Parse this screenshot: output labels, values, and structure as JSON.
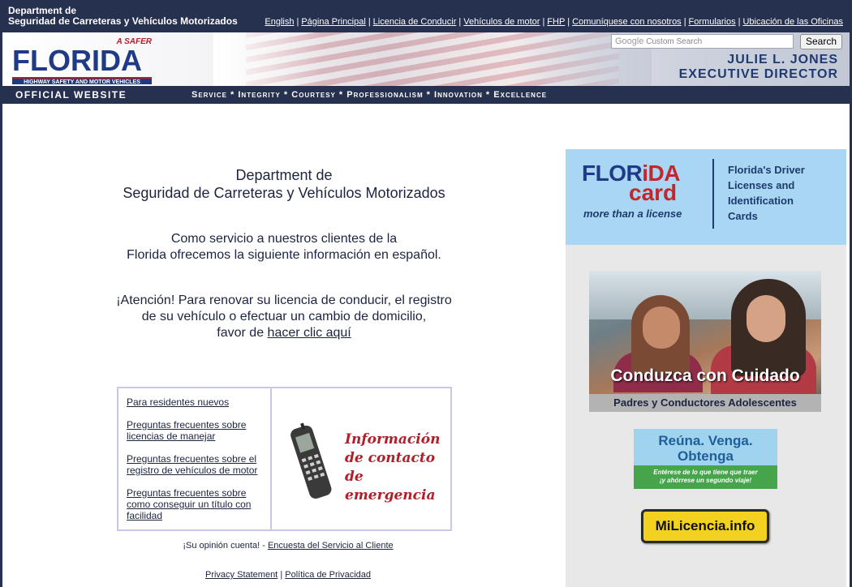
{
  "header": {
    "dept_line1": "Department de",
    "dept_line2": "Seguridad de Carreteras y Vehículos Motorizados",
    "links": [
      "English",
      "Página Principal",
      "Licencia de Conducir",
      "Vehículos de motor",
      "FHP",
      "Comuníquese con nosotros",
      "Formularios",
      "Ubicación de las Oficinas"
    ]
  },
  "banner": {
    "logo_safer": "A SAFER",
    "logo_name": "FLORIDA",
    "logo_sub": "HIGHWAY SAFETY AND MOTOR VEHICLES",
    "search_brand": "Google",
    "search_placeholder": "Custom Search",
    "search_button": "Search",
    "director_name": "JULIE L. JONES",
    "director_title": "EXECUTIVE DIRECTOR"
  },
  "nav": {
    "official": "OFFICIAL WEBSITE",
    "values": "Service * Integrity * Courtesy * Professionalism * Innovation * Excellence"
  },
  "main": {
    "title_line1": "Department de",
    "title_line2": "Seguridad de Carreteras y Vehículos Motorizados",
    "intro_line1": "Como servicio a nuestros clientes de la",
    "intro_line2": "Florida ofrecemos la siguiente información en español.",
    "attn_line1": "¡Atención! Para renovar su licencia de conducir, el registro",
    "attn_line2": "de su vehículo o efectuar un cambio de domicilio,",
    "attn_line3_prefix": "favor de ",
    "attn_link": "hacer clic aquí",
    "info_links": [
      "Para residentes nuevos",
      "Preguntas frecuentes sobre licencias de manejar",
      "Preguntas frecuentes sobre el registro de vehículos de motor",
      "Preguntas frecuentes sobre como conseguir un título con facilidad"
    ],
    "emergency_line1": "Información",
    "emergency_line2": "de contacto de",
    "emergency_line3": "emergencia",
    "opinion_prefix": "¡Su opinión cuenta! - ",
    "opinion_link": "Encuesta del Servicio al Cliente",
    "footer_link1": "Privacy Statement",
    "footer_sep": "|",
    "footer_link2": "Política de Privacidad"
  },
  "sidebar": {
    "flcard_flo": "FLOR",
    "flcard_ida": "iDA",
    "flcard_card": "card",
    "flcard_tag": "more than a license",
    "flcard_desc1": "Florida's Driver",
    "flcard_desc2": "Licenses and",
    "flcard_desc3": "Identification",
    "flcard_desc4": "Cards",
    "teen_caption": "Conduzca con Cuidado",
    "teen_band": "Padres y Conductores Adolescentes",
    "reuna_line1": "Reúna. Venga.",
    "reuna_line2": "Obtenga",
    "reuna_sub1": "Entérese de lo que tiene que traer",
    "reuna_sub2": "¡y ahórrese un segundo viaje!",
    "milicencia": "MiLicencia.info"
  },
  "colors": {
    "navy": "#26304f",
    "brand_blue": "#1f3a86",
    "brand_red": "#c1272d",
    "card_bg": "#a8d6f3",
    "sidebar_bg": "#e8e8e8",
    "milicencia_bg": "#f2d21f"
  }
}
